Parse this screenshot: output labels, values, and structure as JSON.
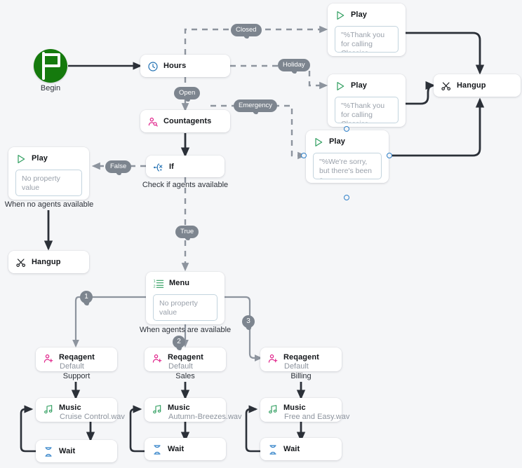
{
  "canvas": {
    "background": "#f5f6f8",
    "accent_blue": "#2f80c8",
    "begin_green": "#157a0d",
    "pill_gray": "#7d858f",
    "edge_dark": "#2b3038",
    "edge_gray": "#8d949e"
  },
  "nodes": {
    "begin": {
      "label": "Begin",
      "icon": "flag-icon"
    },
    "hours": {
      "title": "Hours",
      "icon": "clock-icon"
    },
    "countagents": {
      "title": "Countagents",
      "icon": "count-agents-icon"
    },
    "if": {
      "title": "If",
      "icon": "branch-icon",
      "caption": "Check if agents available"
    },
    "play_no_agents": {
      "title": "Play",
      "icon": "play-icon",
      "property_value": "No property value",
      "caption": "When no agents available"
    },
    "hangup_left": {
      "title": "Hangup",
      "icon": "hangup-icon"
    },
    "play_closed": {
      "title": "Play",
      "icon": "play-icon",
      "property_value": "\"%Thank you for calling Classics, ..."
    },
    "play_holiday": {
      "title": "Play",
      "icon": "play-icon",
      "property_value": "\"%Thank you for calling Classics, ..."
    },
    "play_emergency": {
      "title": "Play",
      "icon": "play-icon",
      "property_value": "\"%We're sorry, but there's been a ..."
    },
    "hangup_right": {
      "title": "Hangup",
      "icon": "hangup-icon"
    },
    "menu": {
      "title": "Menu",
      "icon": "numbered-list-icon",
      "property_value": "No property value",
      "caption": "When agents are available"
    },
    "reqagent_support": {
      "title": "Reqagent",
      "subtitle": "Default",
      "icon": "request-agent-icon",
      "caption": "Support"
    },
    "reqagent_sales": {
      "title": "Reqagent",
      "subtitle": "Default",
      "icon": "request-agent-icon",
      "caption": "Sales"
    },
    "reqagent_billing": {
      "title": "Reqagent",
      "subtitle": "Default",
      "icon": "request-agent-icon",
      "caption": "Billing"
    },
    "music_support": {
      "title": "Music",
      "subtitle": "Cruise Control.wav",
      "icon": "music-icon"
    },
    "music_sales": {
      "title": "Music",
      "subtitle": "Autumn-Breezes.wav",
      "icon": "music-icon"
    },
    "music_billing": {
      "title": "Music",
      "subtitle": "Free and Easy.wav",
      "icon": "music-icon"
    },
    "wait_support": {
      "title": "Wait",
      "icon": "hourglass-icon"
    },
    "wait_sales": {
      "title": "Wait",
      "icon": "hourglass-icon"
    },
    "wait_billing": {
      "title": "Wait",
      "icon": "hourglass-icon"
    }
  },
  "edge_labels": {
    "closed": "Closed",
    "holiday": "Holiday",
    "emergency": "Emergency",
    "open": "Open",
    "false": "False",
    "true": "True",
    "one": "1",
    "two": "2",
    "three": "3"
  }
}
